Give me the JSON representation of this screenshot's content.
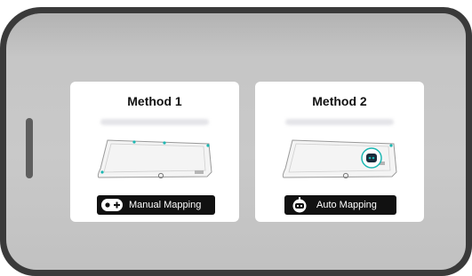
{
  "methods": [
    {
      "title": "Method 1",
      "button_label": "Manual Mapping",
      "button_icon": "manual-control-icon"
    },
    {
      "title": "Method 2",
      "button_label": "Auto Mapping",
      "button_icon": "robot-icon"
    }
  ],
  "colors": {
    "frame": "#3a3a3a",
    "screen_bg": "#c6c6c6",
    "card_bg": "#ffffff",
    "button_bg": "#111111",
    "accent": "#1bb7b2"
  }
}
